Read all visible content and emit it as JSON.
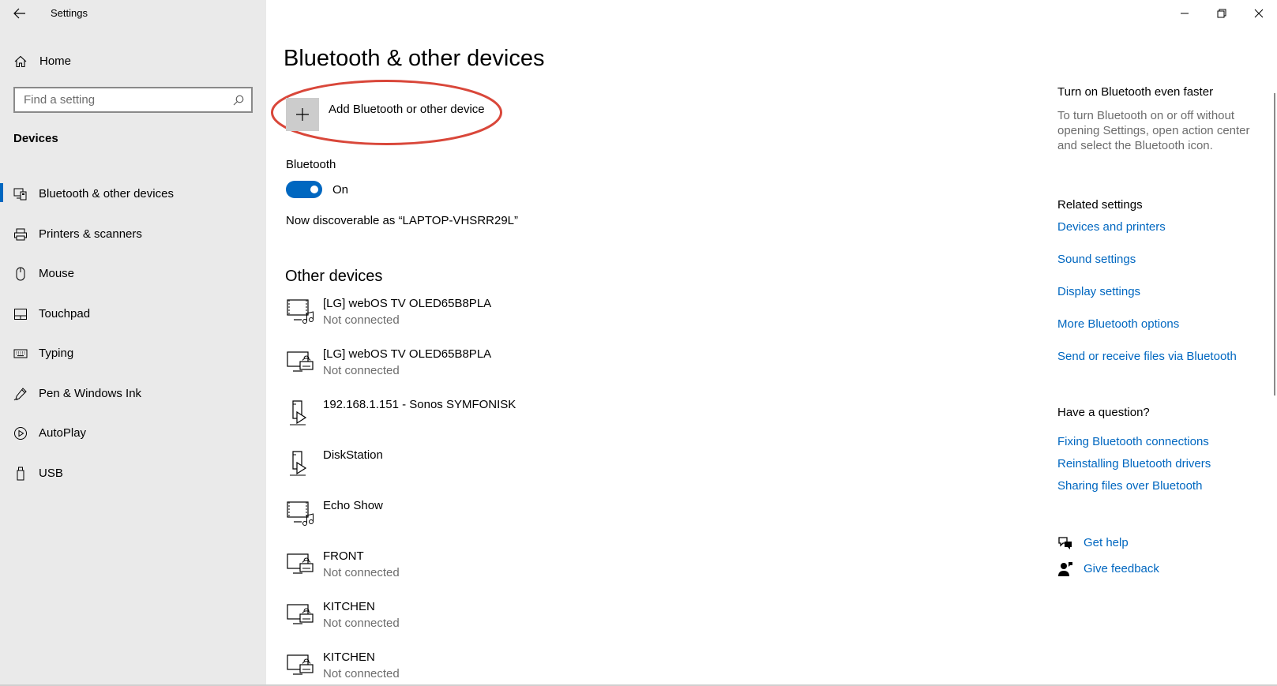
{
  "app": {
    "title": "Settings"
  },
  "sidebar": {
    "home": "Home",
    "search_placeholder": "Find a setting",
    "section": "Devices",
    "items": [
      {
        "label": "Bluetooth & other devices",
        "icon": "bluetooth-devices-icon",
        "active": true
      },
      {
        "label": "Printers & scanners",
        "icon": "printer-icon"
      },
      {
        "label": "Mouse",
        "icon": "mouse-icon"
      },
      {
        "label": "Touchpad",
        "icon": "touchpad-icon"
      },
      {
        "label": "Typing",
        "icon": "keyboard-icon"
      },
      {
        "label": "Pen & Windows Ink",
        "icon": "pen-icon"
      },
      {
        "label": "AutoPlay",
        "icon": "autoplay-icon"
      },
      {
        "label": "USB",
        "icon": "usb-icon"
      }
    ]
  },
  "main": {
    "title": "Bluetooth & other devices",
    "add_device": "Add Bluetooth or other device",
    "bluetooth_label": "Bluetooth",
    "toggle_state": "On",
    "discoverable": "Now discoverable as “LAPTOP-VHSRR29L”",
    "other_devices_title": "Other devices",
    "devices": [
      {
        "name": "[LG] webOS TV OLED65B8PLA",
        "status": "Not connected",
        "icon": "media-device-icon"
      },
      {
        "name": "[LG] webOS TV OLED65B8PLA",
        "status": "Not connected",
        "icon": "network-display-icon"
      },
      {
        "name": "192.168.1.151 - Sonos SYMFONISK",
        "status": "",
        "icon": "media-player-icon"
      },
      {
        "name": "DiskStation",
        "status": "",
        "icon": "media-player-icon"
      },
      {
        "name": "Echo Show",
        "status": "",
        "icon": "media-device-icon"
      },
      {
        "name": "FRONT",
        "status": "Not connected",
        "icon": "network-display-icon"
      },
      {
        "name": "KITCHEN",
        "status": "Not connected",
        "icon": "network-display-icon"
      },
      {
        "name": "KITCHEN",
        "status": "Not connected",
        "icon": "network-display-icon"
      }
    ]
  },
  "right": {
    "faster_title": "Turn on Bluetooth even faster",
    "faster_text": "To turn Bluetooth on or off without opening Settings, open action center and select the Bluetooth icon.",
    "related_title": "Related settings",
    "related_links": [
      "Devices and printers",
      "Sound settings",
      "Display settings",
      "More Bluetooth options",
      "Send or receive files via Bluetooth"
    ],
    "question_title": "Have a question?",
    "question_links": [
      "Fixing Bluetooth connections",
      "Reinstalling Bluetooth drivers",
      "Sharing files over Bluetooth"
    ],
    "get_help": "Get help",
    "give_feedback": "Give feedback"
  },
  "colors": {
    "accent": "#0067c0",
    "sidebar_bg": "#eaeaea",
    "highlight": "#d9473a"
  }
}
